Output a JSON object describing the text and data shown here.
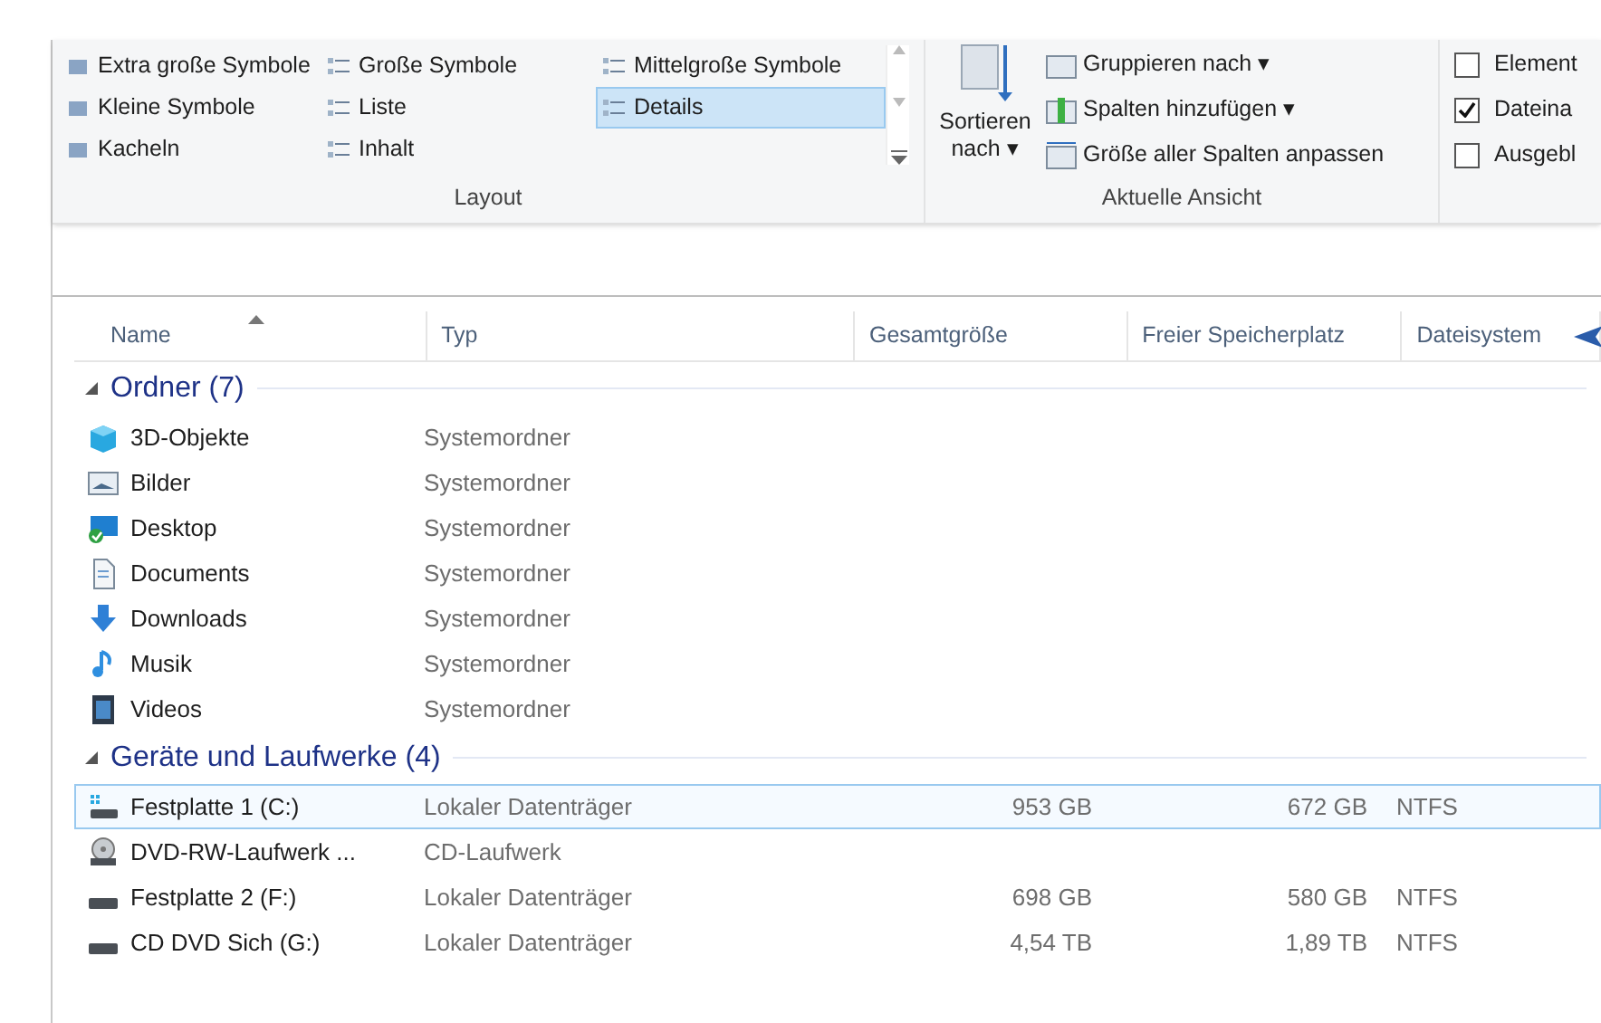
{
  "ribbon": {
    "layout": {
      "items": [
        {
          "label": "Extra große Symbole",
          "selected": false
        },
        {
          "label": "Große Symbole",
          "selected": false
        },
        {
          "label": "Mittelgroße Symbole",
          "selected": false
        },
        {
          "label": "Kleine Symbole",
          "selected": false
        },
        {
          "label": "Liste",
          "selected": false
        },
        {
          "label": "Details",
          "selected": true
        },
        {
          "label": "Kacheln",
          "selected": false
        },
        {
          "label": "Inhalt",
          "selected": false
        }
      ],
      "title": "Layout"
    },
    "current_view": {
      "sort_label_1": "Sortieren",
      "sort_label_2": "nach ▾",
      "group_by": "Gruppieren nach ▾",
      "add_columns": "Spalten hinzufügen ▾",
      "fit_columns": "Größe aller Spalten anpassen",
      "title": "Aktuelle Ansicht"
    },
    "show": [
      {
        "label": "Element",
        "checked": false
      },
      {
        "label": "Dateina",
        "checked": true
      },
      {
        "label": "Ausgebl",
        "checked": false
      }
    ]
  },
  "columns": [
    "Name",
    "Typ",
    "Gesamtgröße",
    "Freier Speicherplatz",
    "Dateisystem"
  ],
  "groups": [
    {
      "title": "Ordner (7)",
      "expanded": true,
      "items": [
        {
          "kind": "objects",
          "name": "3D-Objekte",
          "type": "Systemordner",
          "selected": false
        },
        {
          "kind": "pictures",
          "name": "Bilder",
          "type": "Systemordner",
          "selected": false
        },
        {
          "kind": "desktop",
          "name": "Desktop",
          "type": "Systemordner",
          "selected": false
        },
        {
          "kind": "documents",
          "name": "Documents",
          "type": "Systemordner",
          "selected": false
        },
        {
          "kind": "downloads",
          "name": "Downloads",
          "type": "Systemordner",
          "selected": false
        },
        {
          "kind": "music",
          "name": "Musik",
          "type": "Systemordner",
          "selected": false
        },
        {
          "kind": "videos",
          "name": "Videos",
          "type": "Systemordner",
          "selected": false
        }
      ]
    },
    {
      "title": "Geräte und Laufwerke (4)",
      "expanded": true,
      "items": [
        {
          "kind": "system",
          "name": "Festplatte 1 (C:)",
          "type": "Lokaler Datenträger",
          "total": "953 GB",
          "free": "672 GB",
          "fs": "NTFS",
          "selected": true
        },
        {
          "kind": "dvd",
          "name": "DVD-RW-Laufwerk ...",
          "type": "CD-Laufwerk",
          "selected": false
        },
        {
          "kind": "drive",
          "name": "Festplatte 2 (F:)",
          "type": "Lokaler Datenträger",
          "total": "698 GB",
          "free": "580 GB",
          "fs": "NTFS",
          "selected": false
        },
        {
          "kind": "drive",
          "name": "CD DVD Sich (G:)",
          "type": "Lokaler Datenträger",
          "total": "4,54 TB",
          "free": "1,89 TB",
          "fs": "NTFS",
          "selected": false
        }
      ]
    }
  ]
}
